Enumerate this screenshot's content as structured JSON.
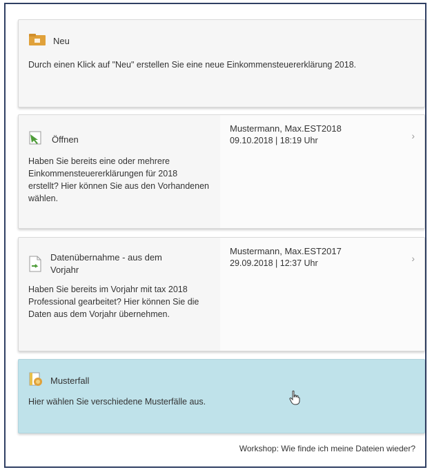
{
  "neu": {
    "title": "Neu",
    "description": "Durch einen Klick auf \"Neu\" erstellen Sie eine neue Einkommensteuererklärung 2018."
  },
  "open": {
    "title": "Öffnen",
    "description": "Haben Sie bereits eine oder mehrere Einkommensteuererklärungen für 2018 erstellt? Hier können Sie aus den Vorhandenen wählen.",
    "entry": {
      "name": "Mustermann, Max.EST2018",
      "date": "09.10.2018 | 18:19 Uhr"
    }
  },
  "previous_year": {
    "title": "Datenübernahme - aus dem Vorjahr",
    "description": "Haben Sie bereits im Vorjahr mit tax 2018 Professional gearbeitet? Hier können Sie die Daten aus dem Vorjahr übernehmen.",
    "entry": {
      "name": "Mustermann, Max.EST2017",
      "date": "29.09.2018 | 12:37 Uhr"
    }
  },
  "sample_case": {
    "title": "Musterfall",
    "description": "Hier wählen Sie verschiedene Musterfälle aus."
  },
  "footer": {
    "link": "Workshop: Wie finde ich meine Dateien wieder?"
  },
  "icons": {
    "neu": "folder-icon",
    "open": "open-file-icon",
    "previous_year": "document-import-icon",
    "sample_case": "sample-case-icon",
    "chevron": "chevron-right-icon",
    "cursor": "hand-cursor-icon"
  },
  "colors": {
    "sample_highlight": "#bfe2ea",
    "folder": "#e0a13a",
    "arrow": "#4f9d3a",
    "frame": "#2f3f63"
  }
}
